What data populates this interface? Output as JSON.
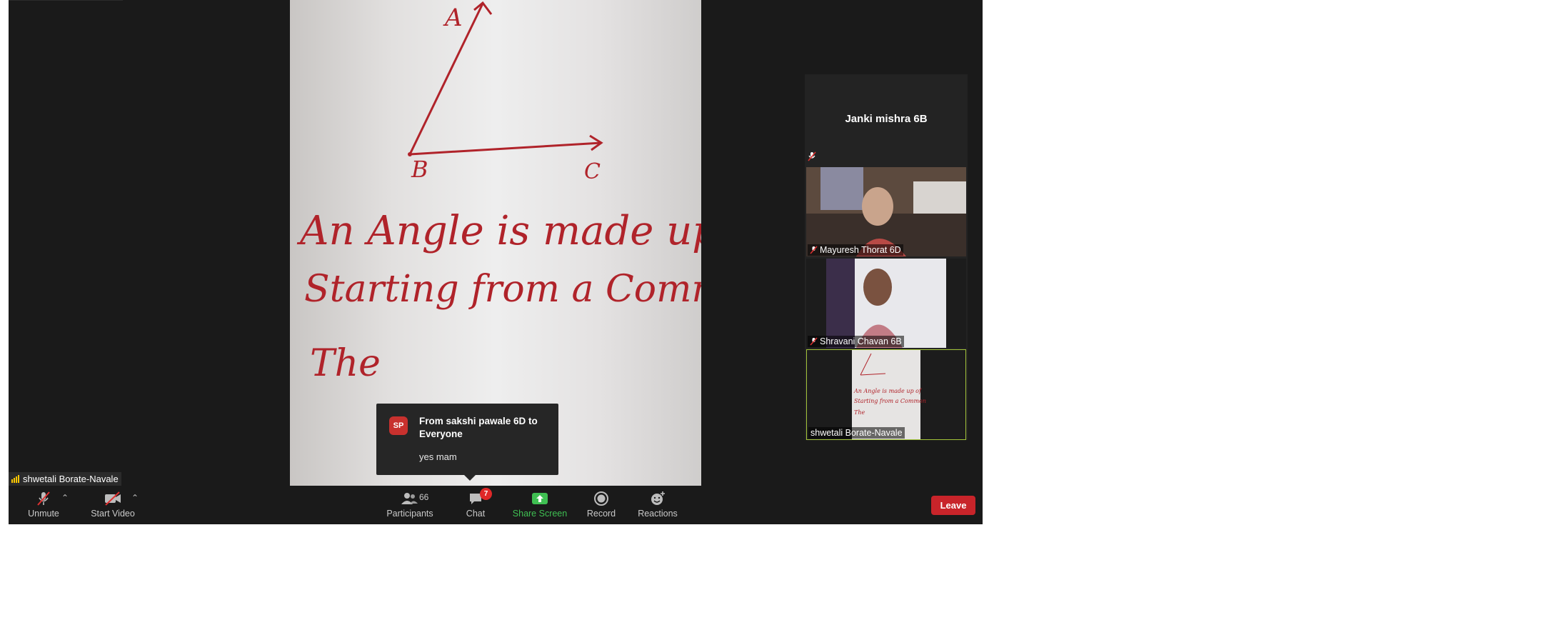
{
  "main_video": {
    "board_label_a": "A",
    "board_label_b": "B",
    "board_label_c": "C",
    "board_line_1": "An Angle is made up of",
    "board_line_2": "Starting from a Common",
    "board_line_3": "The"
  },
  "active_speaker": {
    "name": "shwetali Borate-Navale"
  },
  "gallery": {
    "top_tile_name": "Janki mishra 6B",
    "tiles": [
      {
        "name": "Mayuresh Thorat 6D",
        "muted": true
      },
      {
        "name": "Shravani Chavan 6B",
        "muted": true
      },
      {
        "name": "shwetali Borate-Navale",
        "muted": false,
        "active": true
      }
    ]
  },
  "chat_toast": {
    "avatar_initials": "SP",
    "title": "From sakshi pawale 6D to Everyone",
    "message": "yes mam"
  },
  "toolbar": {
    "unmute_label": "Unmute",
    "start_video_label": "Start Video",
    "participants_label": "Participants",
    "participants_count": "66",
    "chat_label": "Chat",
    "chat_badge": "7",
    "share_screen_label": "Share Screen",
    "record_label": "Record",
    "reactions_label": "Reactions",
    "leave_label": "Leave"
  },
  "colors": {
    "background": "#1a1a1a",
    "share_green": "#3fbf52",
    "leave_red": "#c8242a",
    "active_border": "#a3c43a",
    "ink_red": "#b0232a"
  },
  "icons": [
    "microphone-muted-icon",
    "video-off-icon",
    "participants-icon",
    "chat-icon",
    "share-screen-icon",
    "record-icon",
    "reactions-icon",
    "signal-icon",
    "caret-up-icon"
  ]
}
